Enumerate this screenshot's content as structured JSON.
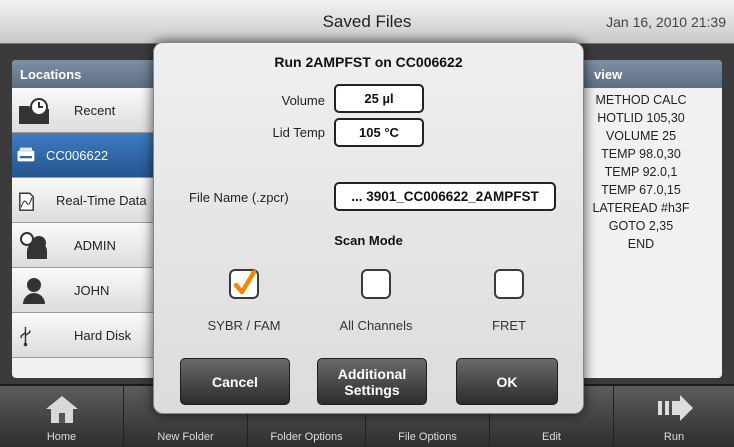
{
  "window": {
    "title": "Saved Files",
    "datetime": "Jan 16, 2010 21:39"
  },
  "locations": {
    "header": "Locations",
    "items": [
      {
        "label": "Recent",
        "icon": "folder-clock-icon"
      },
      {
        "label": "CC006622",
        "icon": "instrument-icon",
        "selected": true
      },
      {
        "label": "Real-Time Data",
        "icon": "data-files-icon"
      },
      {
        "label": "ADMIN",
        "icon": "users-icon"
      },
      {
        "label": "JOHN",
        "icon": "user-icon"
      },
      {
        "label": "Hard Disk",
        "icon": "usb-icon"
      }
    ]
  },
  "preview": {
    "header": "view",
    "lines": [
      "METHOD CALC",
      "HOTLID 105,30",
      "VOLUME 25",
      "TEMP 98.0,30",
      "TEMP 92.0,1",
      "TEMP 67.0,15",
      "LATEREAD #h3F",
      "GOTO 2,35",
      "END"
    ]
  },
  "toolbar": {
    "buttons": [
      "Home",
      "New Folder",
      "Folder Options",
      "File Options",
      "Edit",
      "Run"
    ]
  },
  "dialog": {
    "title": "Run 2AMPFST on CC006622",
    "volume_label": "Volume",
    "volume_value": "25 µl",
    "lidtemp_label": "Lid Temp",
    "lidtemp_value": "105 °C",
    "filename_label": "File Name (.zpcr)",
    "filename_value": "... 3901_CC006622_2AMPFST",
    "scan_mode_title": "Scan Mode",
    "scan_modes": [
      {
        "label": "SYBR / FAM",
        "checked": true
      },
      {
        "label": "All Channels",
        "checked": false
      },
      {
        "label": "FRET",
        "checked": false
      }
    ],
    "cancel_label": "Cancel",
    "additional_label_1": "Additional",
    "additional_label_2": "Settings",
    "ok_label": "OK"
  },
  "colors": {
    "accent_check": "#f08a00",
    "selection": "#2c64a4"
  }
}
